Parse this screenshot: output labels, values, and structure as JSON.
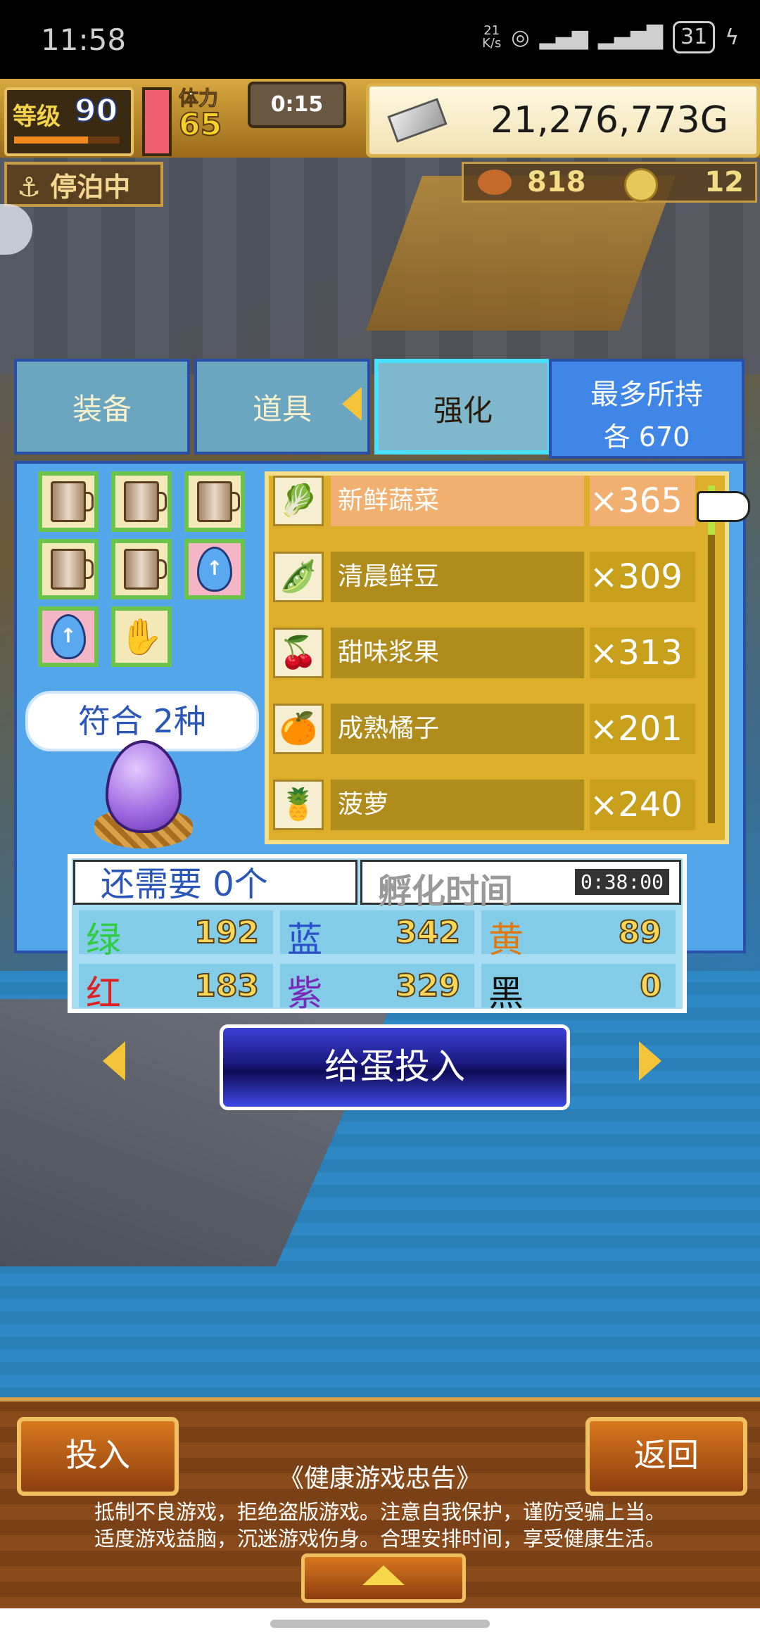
{
  "status_bar": {
    "time": "11:58",
    "net_speed_top": "21",
    "net_speed_unit": "K/s",
    "signal_label": "1",
    "battery": "31"
  },
  "hud": {
    "level_label": "等级",
    "level": "90",
    "stamina_label": "体力",
    "stamina": "65",
    "timer": "0:15",
    "gold": "21,276,773G",
    "dock_status": "停泊中",
    "food": "818",
    "medals": "12"
  },
  "tabs": [
    {
      "label": "装备"
    },
    {
      "label": "道具"
    },
    {
      "label": "强化"
    }
  ],
  "max_hold": {
    "line1": "最多所持",
    "line2": "各 670"
  },
  "slots": [
    {
      "icon": "mug-icon"
    },
    {
      "icon": "mug-icon"
    },
    {
      "icon": "mug-icon"
    },
    {
      "icon": "mug-icon"
    },
    {
      "icon": "mug-icon"
    },
    {
      "icon": "blue-egg-icon"
    },
    {
      "icon": "blue-egg-icon"
    },
    {
      "icon": "glove-icon"
    }
  ],
  "match_text": "符合 2种",
  "items": [
    {
      "name": "新鲜蔬菜",
      "count": "×365",
      "icon": "vegetable-icon",
      "selected": true
    },
    {
      "name": "清晨鲜豆",
      "count": "×309",
      "icon": "beans-icon"
    },
    {
      "name": "甜味浆果",
      "count": "×313",
      "icon": "berries-icon"
    },
    {
      "name": "成熟橘子",
      "count": "×201",
      "icon": "orange-icon"
    },
    {
      "name": "菠萝",
      "count": "×240",
      "icon": "pineapple-icon"
    }
  ],
  "need_text": "还需要 0个",
  "hatch": {
    "label": "孵化时间",
    "time": "0:38:00"
  },
  "stats": [
    {
      "key": "绿",
      "value": "192",
      "color": "#2ecc40"
    },
    {
      "key": "蓝",
      "value": "342",
      "color": "#2a4fc8"
    },
    {
      "key": "黄",
      "value": "89",
      "color": "#e07a10"
    },
    {
      "key": "红",
      "value": "183",
      "color": "#e02020"
    },
    {
      "key": "紫",
      "value": "329",
      "color": "#7a2ab8"
    },
    {
      "key": "黑",
      "value": "0",
      "color": "#111111"
    }
  ],
  "feed_button": "给蛋投入",
  "bottom": {
    "put_in": "投入",
    "back": "返回",
    "notice_title": "《健康游戏忠告》",
    "notice_line1": "抵制不良游戏，拒绝盗版游戏。注意自我保护，谨防受骗上当。",
    "notice_line2": "适度游戏益脑，沉迷游戏伤身。合理安排时间，享受健康生活。"
  }
}
